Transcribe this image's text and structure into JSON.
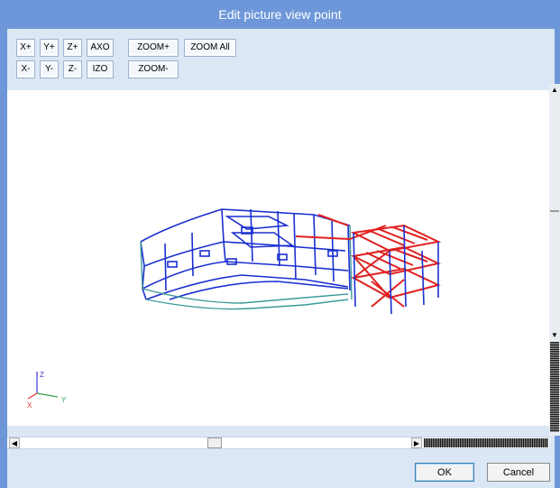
{
  "window": {
    "title": "Edit picture view point"
  },
  "toolbar": {
    "x_plus": "X+",
    "y_plus": "Y+",
    "z_plus": "Z+",
    "axo": "AXO",
    "zoom_plus": "ZOOM+",
    "zoom_all": "ZOOM All",
    "x_minus": "X-",
    "y_minus": "Y-",
    "z_minus": "Z-",
    "izo": "IZO",
    "zoom_minus": "ZOOM-"
  },
  "axes": {
    "z_label": "Z",
    "x_label": "X",
    "y_label": "Y",
    "z_color": "#3a3ad0",
    "x_color": "#e03030",
    "y_color": "#3aa050"
  },
  "model_colors": {
    "blue": "#1a2fd0",
    "red": "#e02020",
    "teal": "#3a9a9a"
  },
  "footer": {
    "ok_label": "OK",
    "cancel_label": "Cancel"
  }
}
